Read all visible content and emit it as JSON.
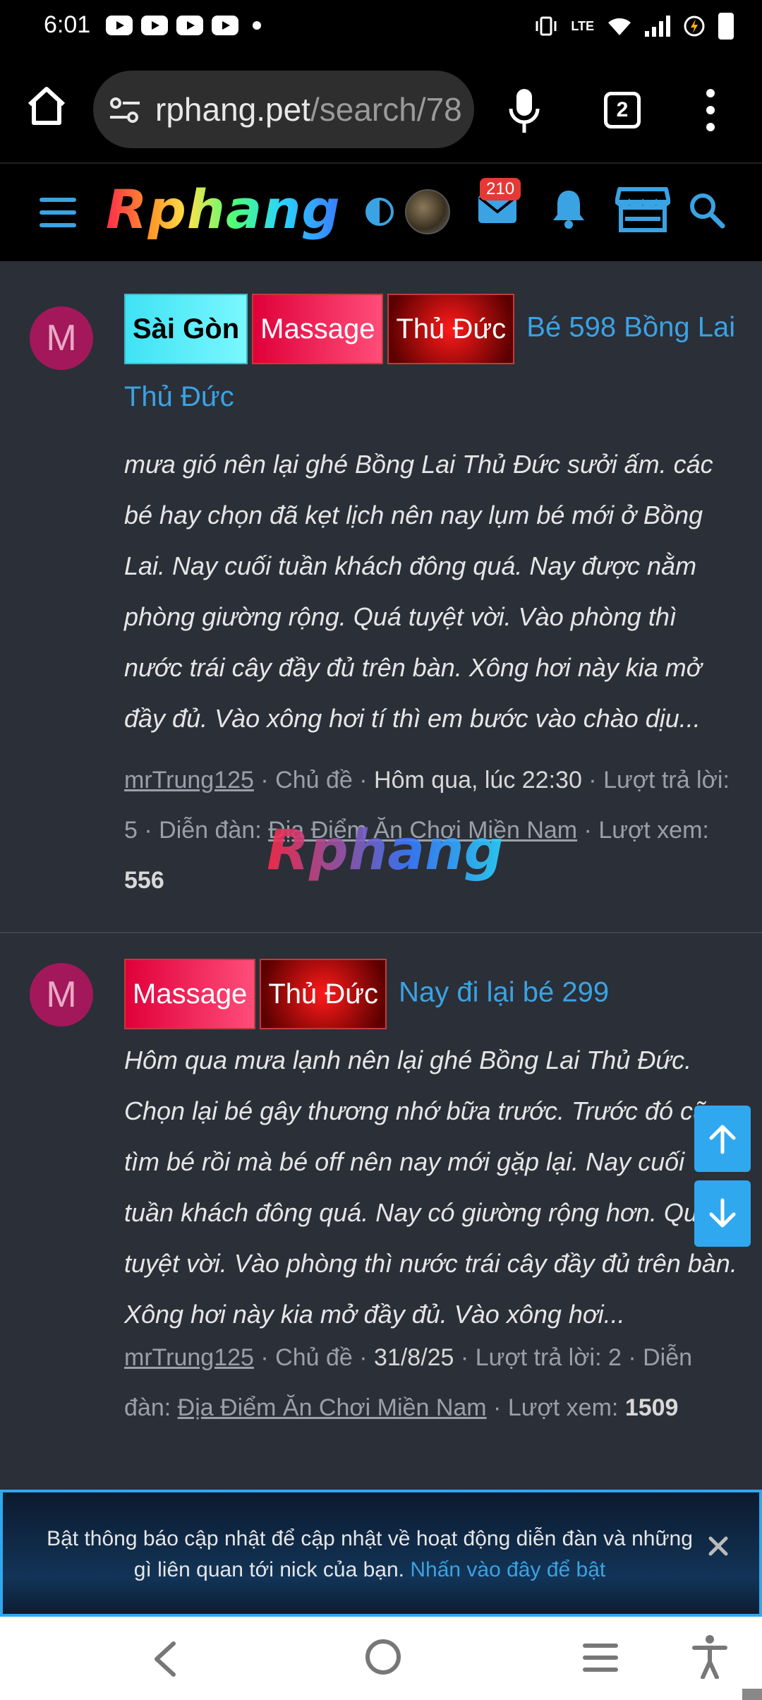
{
  "status_bar": {
    "time": "6:01",
    "network_label": "LTE"
  },
  "browser": {
    "url_host": "rphang.pet",
    "url_path": "/search/78",
    "tab_count": "2"
  },
  "site": {
    "logo_text": "Rphang",
    "inbox_badge": "210",
    "watermark_text": "Rphang"
  },
  "posts": [
    {
      "avatar_letter": "M",
      "tags": [
        "Sài Gòn",
        "Massage",
        "Thủ Đức"
      ],
      "title": "Bé 598 Bồng Lai Thủ Đức",
      "excerpt": "mưa gió nên lại ghé Bồng Lai Thủ Đức sưởi ấm. các bé hay chọn đã kẹt lịch nên nay lụm bé mới ở Bồng Lai. Nay cuối tuần khách đông quá. Nay được nằm phòng giường rộng. Quá tuyệt vời. Vào phòng thì nước trái cây đầy đủ trên bàn. Xông hơi này kia mở đầy đủ. Vào xông hơi tí thì em bước vào chào dịu...",
      "author": "mrTrung125",
      "type_label": "Chủ đề",
      "date": "Hôm qua, lúc 22:30",
      "replies_label": "Lượt trả lời: 5",
      "forum_label": "Diễn đàn:",
      "forum": "Địa Điểm Ăn Chơi Miền Nam",
      "views_label": "Lượt xem:",
      "views": "556"
    },
    {
      "avatar_letter": "M",
      "tags": [
        "Massage",
        "Thủ Đức"
      ],
      "title": "Nay đi lại bé 299",
      "excerpt": "Hôm qua mưa lạnh nên lại ghé Bồng Lai Thủ Đức. Chọn lại bé gây thương nhớ bữa trước. Trước đó cũ tìm bé rồi mà bé off nên nay mới gặp lại. Nay cuối tuần khách đông quá. Nay có giường rộng hơn. Quá tuyệt vời. Vào phòng thì nước trái cây đầy đủ trên bàn. Xông hơi này kia mở đầy đủ. Vào xông hơi...",
      "author": "mrTrung125",
      "type_label": "Chủ đề",
      "date": "31/8/25",
      "replies_label": "Lượt trả lời: 2",
      "forum_label": "Diễn đàn:",
      "forum": "Địa Điểm Ăn Chơi Miền Nam",
      "views_label": "Lượt xem:",
      "views": "1509"
    }
  ],
  "notice": {
    "text": "Bật thông báo cập nhật để cập nhật về hoạt động diễn đàn và những gì liên quan tới nick của bạn.",
    "link": "Nhấn vào đây để bật"
  },
  "colors": {
    "accent": "#3aa3e3",
    "background": "#2b2f38",
    "avatar": "#a3185a",
    "fab": "#2fa8f0",
    "badge": "#e53935"
  },
  "icons": {
    "home": "home-icon",
    "tune": "site-settings-icon",
    "mic": "mic-icon",
    "menu": "more-vert-icon",
    "hamburger": "hamburger-icon",
    "contrast": "contrast-icon",
    "mail": "mail-icon",
    "bell": "bell-icon",
    "store": "store-icon",
    "search": "search-icon",
    "scroll_up": "arrow-up-icon",
    "scroll_down": "arrow-down-icon",
    "close": "close-icon",
    "back": "back-icon",
    "accessibility": "accessibility-icon"
  }
}
